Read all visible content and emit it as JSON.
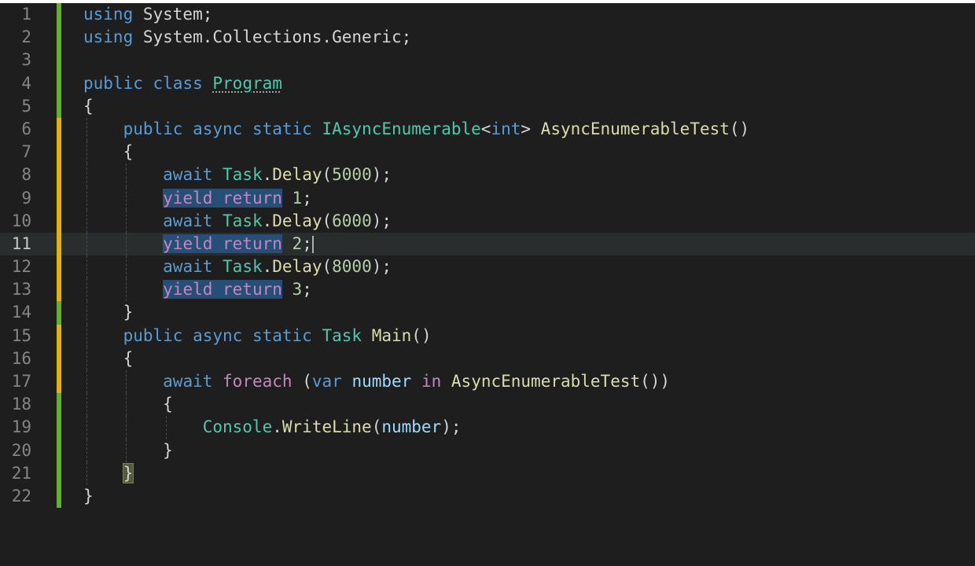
{
  "editor": {
    "lines": [
      {
        "number": "1",
        "tokens": [
          {
            "t": "using",
            "c": "kw"
          },
          {
            "t": " System;",
            "c": "punc"
          }
        ]
      },
      {
        "number": "2",
        "tokens": [
          {
            "t": "using",
            "c": "kw"
          },
          {
            "t": " System.Collections.Generic;",
            "c": "punc"
          }
        ]
      },
      {
        "number": "3",
        "tokens": []
      },
      {
        "number": "4",
        "tokens": [
          {
            "t": "public",
            "c": "kw"
          },
          {
            "t": " "
          },
          {
            "t": "class",
            "c": "kw"
          },
          {
            "t": " "
          },
          {
            "t": "Program",
            "c": "cls squiggle"
          }
        ]
      },
      {
        "number": "5",
        "tokens": [
          {
            "t": "{",
            "c": "punc"
          }
        ]
      },
      {
        "number": "6",
        "tokens": [
          {
            "t": "    "
          },
          {
            "t": "public",
            "c": "kw"
          },
          {
            "t": " "
          },
          {
            "t": "async",
            "c": "kw"
          },
          {
            "t": " "
          },
          {
            "t": "static",
            "c": "kw"
          },
          {
            "t": " "
          },
          {
            "t": "IAsyncEnumerable",
            "c": "cls"
          },
          {
            "t": "<",
            "c": "punc"
          },
          {
            "t": "int",
            "c": "kw"
          },
          {
            "t": "> ",
            "c": "punc"
          },
          {
            "t": "AsyncEnumerableTest",
            "c": "fn"
          },
          {
            "t": "()",
            "c": "punc"
          }
        ]
      },
      {
        "number": "7",
        "tokens": [
          {
            "t": "    "
          },
          {
            "t": "{",
            "c": "punc"
          }
        ]
      },
      {
        "number": "8",
        "tokens": [
          {
            "t": "        "
          },
          {
            "t": "await",
            "c": "kw"
          },
          {
            "t": " "
          },
          {
            "t": "Task",
            "c": "cls"
          },
          {
            "t": ".",
            "c": "punc"
          },
          {
            "t": "Delay",
            "c": "fn"
          },
          {
            "t": "(",
            "c": "punc"
          },
          {
            "t": "5000",
            "c": "num"
          },
          {
            "t": ");",
            "c": "punc"
          }
        ]
      },
      {
        "number": "9",
        "tokens": [
          {
            "t": "        "
          },
          {
            "t": "yield return",
            "c": "ctrl sel"
          },
          {
            "t": " "
          },
          {
            "t": "1",
            "c": "num"
          },
          {
            "t": ";",
            "c": "punc"
          }
        ]
      },
      {
        "number": "10",
        "tokens": [
          {
            "t": "        "
          },
          {
            "t": "await",
            "c": "kw"
          },
          {
            "t": " "
          },
          {
            "t": "Task",
            "c": "cls"
          },
          {
            "t": ".",
            "c": "punc"
          },
          {
            "t": "Delay",
            "c": "fn"
          },
          {
            "t": "(",
            "c": "punc"
          },
          {
            "t": "6000",
            "c": "num"
          },
          {
            "t": ");",
            "c": "punc"
          }
        ]
      },
      {
        "number": "11",
        "tokens": [
          {
            "t": "        "
          },
          {
            "t": "yield return",
            "c": "ctrl sel"
          },
          {
            "t": " "
          },
          {
            "t": "2",
            "c": "num"
          },
          {
            "t": ";",
            "c": "punc"
          },
          {
            "t": "",
            "c": "cursor"
          }
        ],
        "current": true
      },
      {
        "number": "12",
        "tokens": [
          {
            "t": "        "
          },
          {
            "t": "await",
            "c": "kw"
          },
          {
            "t": " "
          },
          {
            "t": "Task",
            "c": "cls"
          },
          {
            "t": ".",
            "c": "punc"
          },
          {
            "t": "Delay",
            "c": "fn"
          },
          {
            "t": "(",
            "c": "punc"
          },
          {
            "t": "8000",
            "c": "num"
          },
          {
            "t": ");",
            "c": "punc"
          }
        ]
      },
      {
        "number": "13",
        "tokens": [
          {
            "t": "        "
          },
          {
            "t": "yield return",
            "c": "ctrl sel"
          },
          {
            "t": " "
          },
          {
            "t": "3",
            "c": "num"
          },
          {
            "t": ";",
            "c": "punc"
          }
        ]
      },
      {
        "number": "14",
        "tokens": [
          {
            "t": "    "
          },
          {
            "t": "}",
            "c": "punc"
          }
        ]
      },
      {
        "number": "15",
        "tokens": [
          {
            "t": "    "
          },
          {
            "t": "public",
            "c": "kw"
          },
          {
            "t": " "
          },
          {
            "t": "async",
            "c": "kw"
          },
          {
            "t": " "
          },
          {
            "t": "static",
            "c": "kw"
          },
          {
            "t": " "
          },
          {
            "t": "Task",
            "c": "cls"
          },
          {
            "t": " "
          },
          {
            "t": "Main",
            "c": "fn"
          },
          {
            "t": "()",
            "c": "punc"
          }
        ]
      },
      {
        "number": "16",
        "tokens": [
          {
            "t": "    "
          },
          {
            "t": "{",
            "c": "punc"
          }
        ]
      },
      {
        "number": "17",
        "tokens": [
          {
            "t": "        "
          },
          {
            "t": "await",
            "c": "kw"
          },
          {
            "t": " "
          },
          {
            "t": "foreach",
            "c": "ctrl"
          },
          {
            "t": " (",
            "c": "punc"
          },
          {
            "t": "var",
            "c": "kw"
          },
          {
            "t": " "
          },
          {
            "t": "number",
            "c": "var"
          },
          {
            "t": " "
          },
          {
            "t": "in",
            "c": "ctrl"
          },
          {
            "t": " "
          },
          {
            "t": "AsyncEnumerableTest",
            "c": "fn"
          },
          {
            "t": "())",
            "c": "punc"
          }
        ]
      },
      {
        "number": "18",
        "tokens": [
          {
            "t": "        "
          },
          {
            "t": "{",
            "c": "punc"
          }
        ]
      },
      {
        "number": "19",
        "tokens": [
          {
            "t": "            "
          },
          {
            "t": "Console",
            "c": "cls"
          },
          {
            "t": ".",
            "c": "punc"
          },
          {
            "t": "WriteLine",
            "c": "fn"
          },
          {
            "t": "(",
            "c": "punc"
          },
          {
            "t": "number",
            "c": "var"
          },
          {
            "t": ");",
            "c": "punc"
          }
        ]
      },
      {
        "number": "20",
        "tokens": [
          {
            "t": "        "
          },
          {
            "t": "}",
            "c": "punc"
          }
        ]
      },
      {
        "number": "21",
        "tokens": [
          {
            "t": "    "
          },
          {
            "t": "}",
            "c": "punc brace-match"
          }
        ]
      },
      {
        "number": "22",
        "tokens": [
          {
            "t": "}",
            "c": "punc"
          }
        ]
      }
    ],
    "gutter_modified_lines": [
      "6",
      "7",
      "8",
      "9",
      "10",
      "11",
      "12",
      "13",
      "15",
      "16",
      "17"
    ],
    "colors": {
      "background": "#1e1e1e",
      "keyword": "#569cd6",
      "control": "#c586c0",
      "type": "#4ec9b0",
      "function": "#dcdcaa",
      "number": "#b5cea8",
      "variable": "#9cdcfe",
      "gutter_added": "#64b22b",
      "gutter_modified": "#e2b400"
    }
  }
}
